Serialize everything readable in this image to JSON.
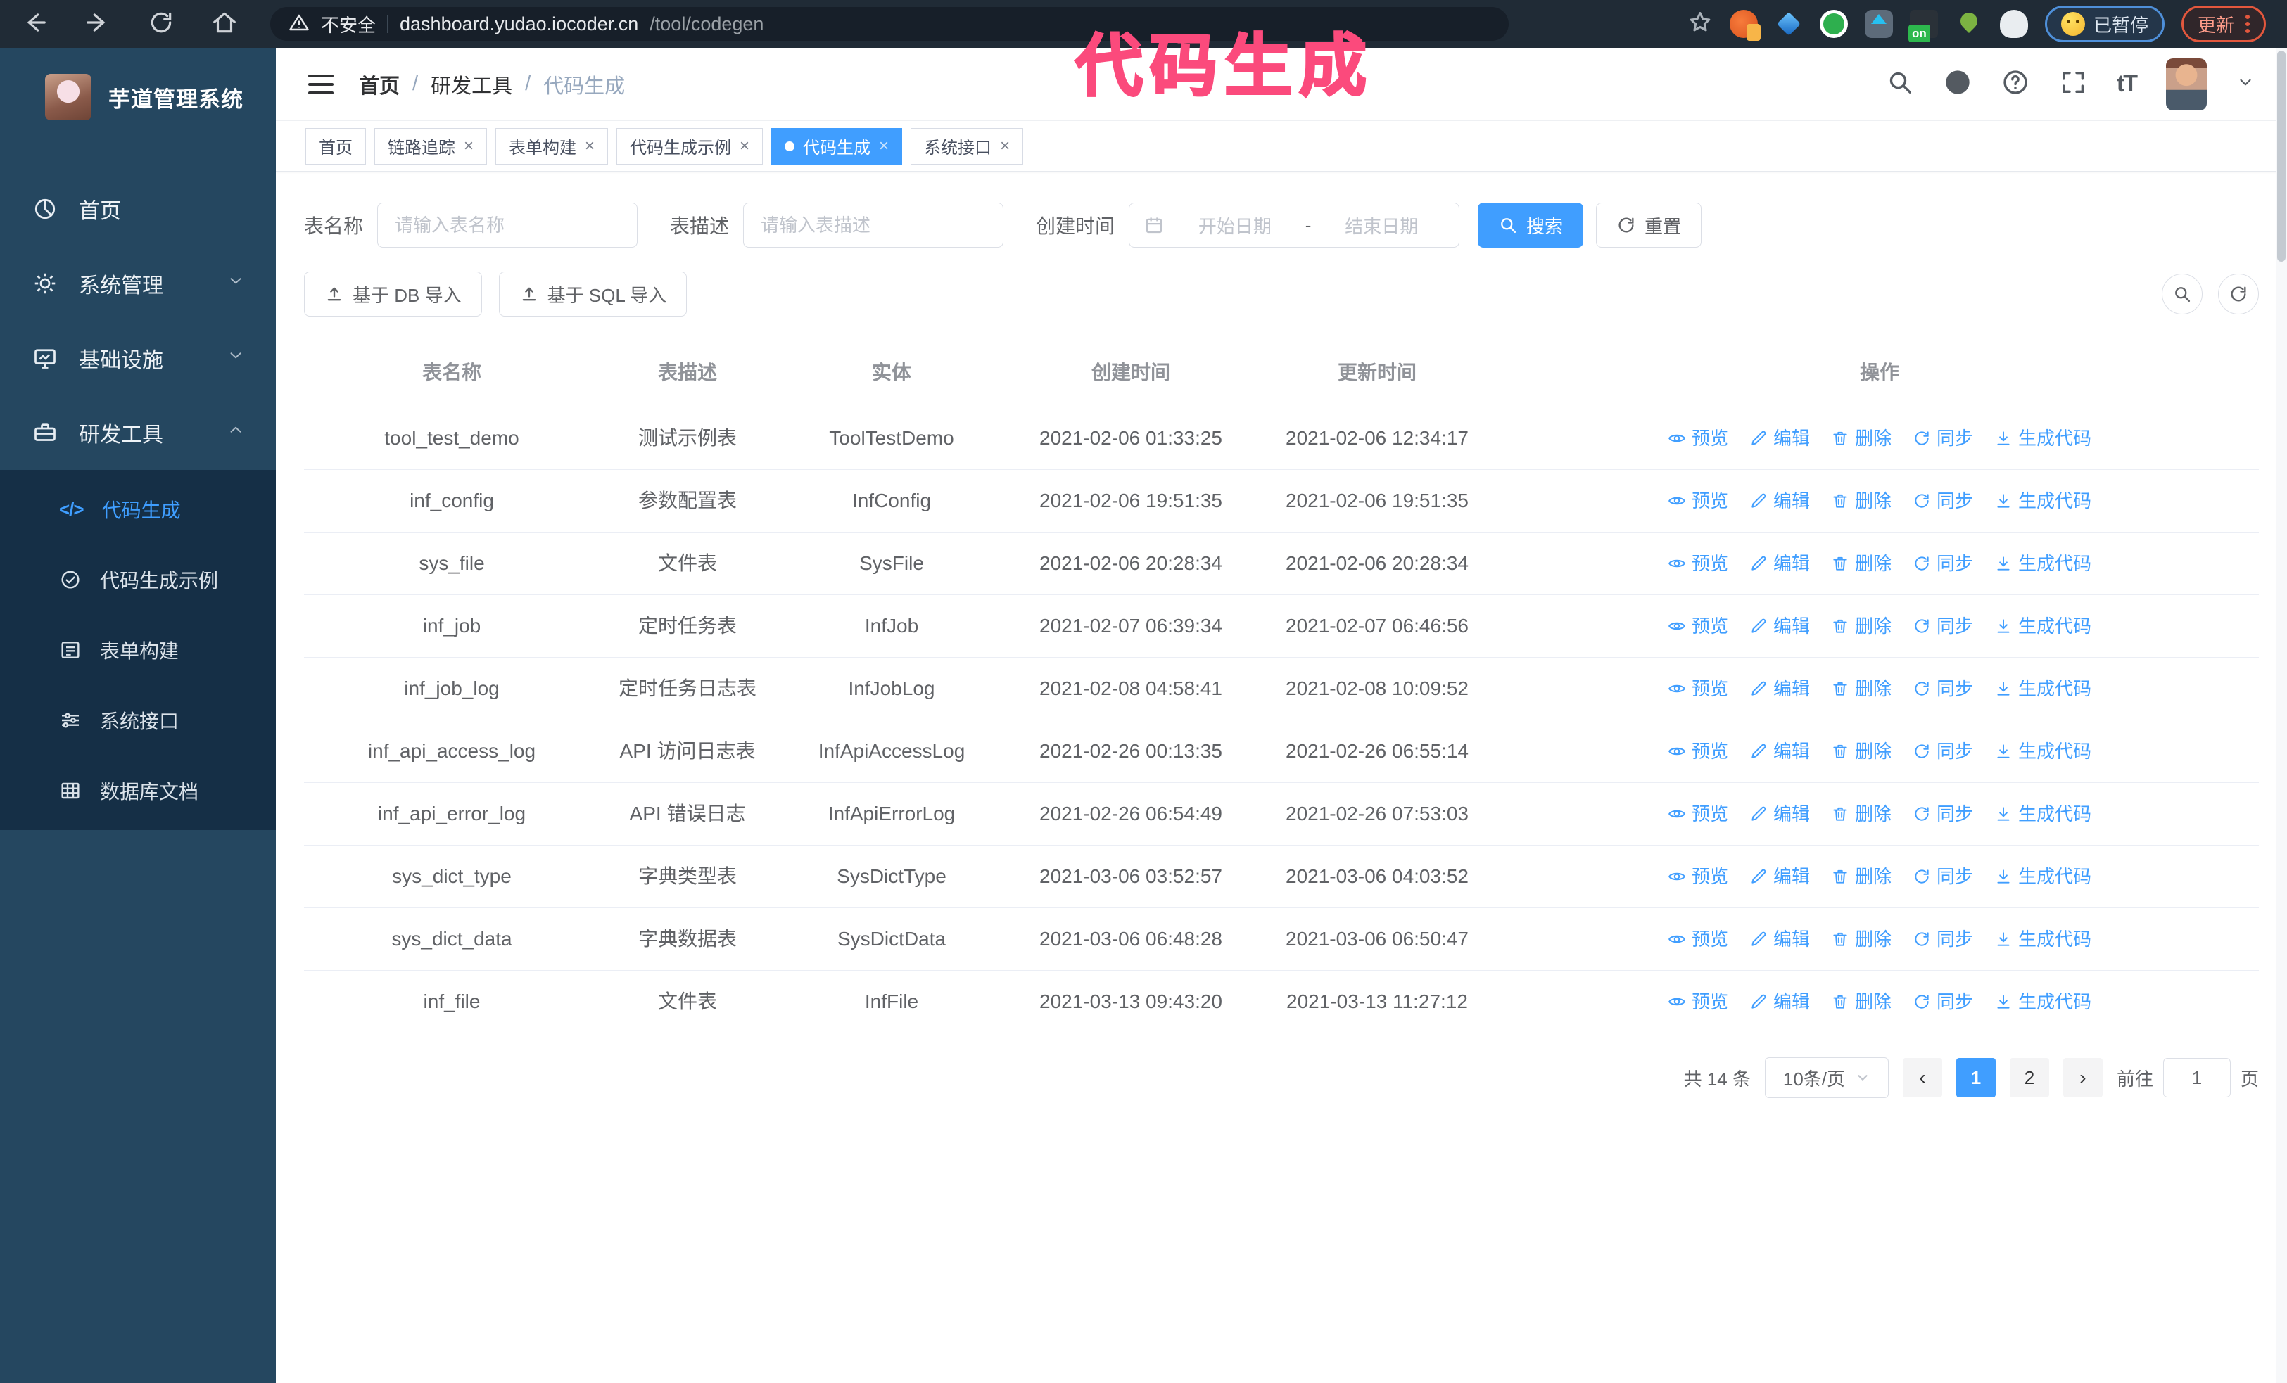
{
  "browser": {
    "security_warning": "不安全",
    "url_host": "dashboard.yudao.iocoder.cn",
    "url_path": "/tool/codegen",
    "paused_badge": "已暂停",
    "update_button": "更新",
    "extension_on_badge": "on"
  },
  "annotation": {
    "text": "代码生成",
    "color": "#fb4a7c"
  },
  "sidebar": {
    "title": "芋道管理系统",
    "items": [
      {
        "label": "首页"
      },
      {
        "label": "系统管理"
      },
      {
        "label": "基础设施"
      },
      {
        "label": "研发工具"
      }
    ],
    "submenu": [
      {
        "label": "代码生成",
        "active": true
      },
      {
        "label": "代码生成示例"
      },
      {
        "label": "表单构建"
      },
      {
        "label": "系统接口"
      },
      {
        "label": "数据库文档"
      }
    ]
  },
  "header": {
    "breadcrumb": [
      "首页",
      "研发工具",
      "代码生成"
    ],
    "font_icon_text": "tT"
  },
  "icons": {
    "breadcrumb_sep": "/",
    "close": "×",
    "prev_arrow": "‹",
    "next_arrow": "›",
    "code_glyph": "</>"
  },
  "tabs": [
    {
      "label": "首页"
    },
    {
      "label": "链路追踪"
    },
    {
      "label": "表单构建"
    },
    {
      "label": "代码生成示例"
    },
    {
      "label": "代码生成"
    },
    {
      "label": "系统接口"
    }
  ],
  "filters": {
    "table_name_label": "表名称",
    "table_name_placeholder": "请输入表名称",
    "table_desc_label": "表描述",
    "table_desc_placeholder": "请输入表描述",
    "create_time_label": "创建时间",
    "date_start_placeholder": "开始日期",
    "date_separator": "-",
    "date_end_placeholder": "结束日期",
    "search_label": "搜索",
    "reset_label": "重置"
  },
  "toolbar": {
    "import_db_label": "基于 DB 导入",
    "import_sql_label": "基于 SQL 导入"
  },
  "table": {
    "columns": [
      "表名称",
      "表描述",
      "实体",
      "创建时间",
      "更新时间",
      "操作"
    ],
    "actions": [
      "预览",
      "编辑",
      "删除",
      "同步",
      "生成代码"
    ],
    "rows": [
      {
        "name": "tool_test_demo",
        "desc": "测试示例表",
        "entity": "ToolTestDemo",
        "created": "2021-02-06 01:33:25",
        "updated": "2021-02-06 12:34:17"
      },
      {
        "name": "inf_config",
        "desc": "参数配置表",
        "entity": "InfConfig",
        "created": "2021-02-06 19:51:35",
        "updated": "2021-02-06 19:51:35"
      },
      {
        "name": "sys_file",
        "desc": "文件表",
        "entity": "SysFile",
        "created": "2021-02-06 20:28:34",
        "updated": "2021-02-06 20:28:34"
      },
      {
        "name": "inf_job",
        "desc": "定时任务表",
        "entity": "InfJob",
        "created": "2021-02-07 06:39:34",
        "updated": "2021-02-07 06:46:56"
      },
      {
        "name": "inf_job_log",
        "desc": "定时任务日志表",
        "entity": "InfJobLog",
        "created": "2021-02-08 04:58:41",
        "updated": "2021-02-08 10:09:52"
      },
      {
        "name": "inf_api_access_log",
        "desc": "API 访问日志表",
        "entity": "InfApiAccessLog",
        "created": "2021-02-26 00:13:35",
        "updated": "2021-02-26 06:55:14"
      },
      {
        "name": "inf_api_error_log",
        "desc": "API 错误日志",
        "entity": "InfApiErrorLog",
        "created": "2021-02-26 06:54:49",
        "updated": "2021-02-26 07:53:03"
      },
      {
        "name": "sys_dict_type",
        "desc": "字典类型表",
        "entity": "SysDictType",
        "created": "2021-03-06 03:52:57",
        "updated": "2021-03-06 04:03:52"
      },
      {
        "name": "sys_dict_data",
        "desc": "字典数据表",
        "entity": "SysDictData",
        "created": "2021-03-06 06:48:28",
        "updated": "2021-03-06 06:50:47"
      },
      {
        "name": "inf_file",
        "desc": "文件表",
        "entity": "InfFile",
        "created": "2021-03-13 09:43:20",
        "updated": "2021-03-13 11:27:12"
      }
    ]
  },
  "pagination": {
    "total": "共 14 条",
    "page_size": "10条/页",
    "pages": [
      "1",
      "2"
    ],
    "active_page": "1",
    "goto_label": "前往",
    "goto_value": "1",
    "goto_suffix": "页"
  },
  "colors": {
    "accent": "#409eff",
    "sidebar_bg": "#254760",
    "submenu_bg": "#152f46",
    "annotation_pink": "#fb4a7c",
    "paused_border": "#4e8fd9",
    "update_border": "#e2573d",
    "browser_bar_bg": "#202b36"
  }
}
